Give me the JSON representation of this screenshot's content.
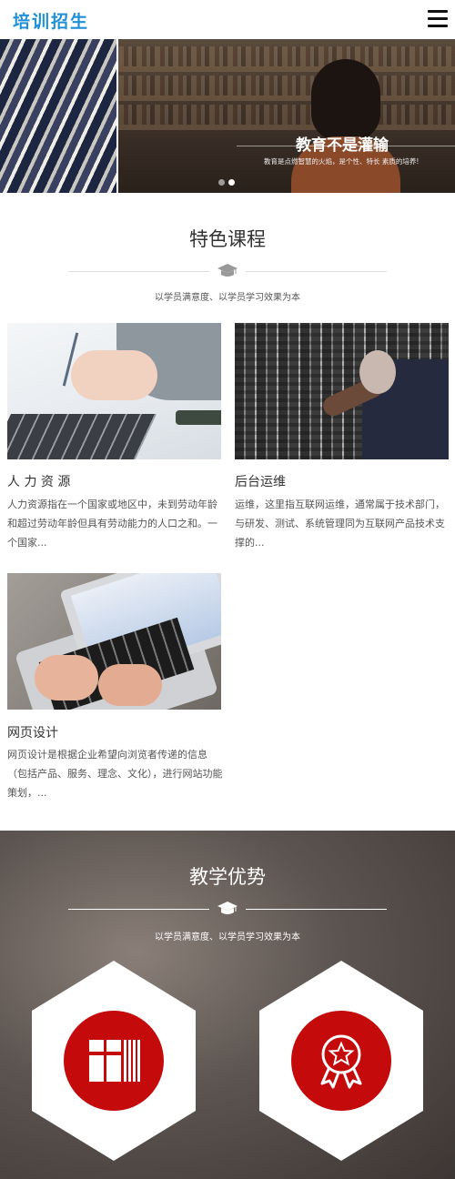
{
  "header": {
    "logo": "培训招生",
    "menu_icon": "hamburger-menu-icon"
  },
  "banner": {
    "title": "教育不是灌输",
    "subtitle": "教育是点燃智慧的火焰，是个性、特长  素质的培养!",
    "slides": 2,
    "active_slide": 2
  },
  "courses": {
    "title": "特色课程",
    "icon": "graduation-cap-icon",
    "subtitle": "以学员满意度、以学员学习效果为本",
    "items": [
      {
        "title": "人 力 资 源",
        "desc": "人力资源指在一个国家或地区中，未到劳动年龄和超过劳动年龄但具有劳动能力的人口之和。一个国家..."
      },
      {
        "title": "后台运维",
        "desc": "运维，这里指互联网运维，通常属于技术部门，与研发、测试、系统管理同为互联网产品技术支撑的..."
      },
      {
        "title": "网页设计",
        "desc": "网页设计是根据企业希望向浏览者传递的信息（包括产品、服务、理念、文化），进行网站功能策划，..."
      }
    ]
  },
  "advantages": {
    "title": "教学优势",
    "icon": "graduation-cap-icon",
    "subtitle": "以学员满意度、以学员学习效果为本",
    "items": [
      {
        "icon": "books-icon"
      },
      {
        "icon": "award-ribbon-icon"
      }
    ]
  },
  "colors": {
    "logo": "#1f8fd6",
    "accent_red": "#c40a0a"
  }
}
